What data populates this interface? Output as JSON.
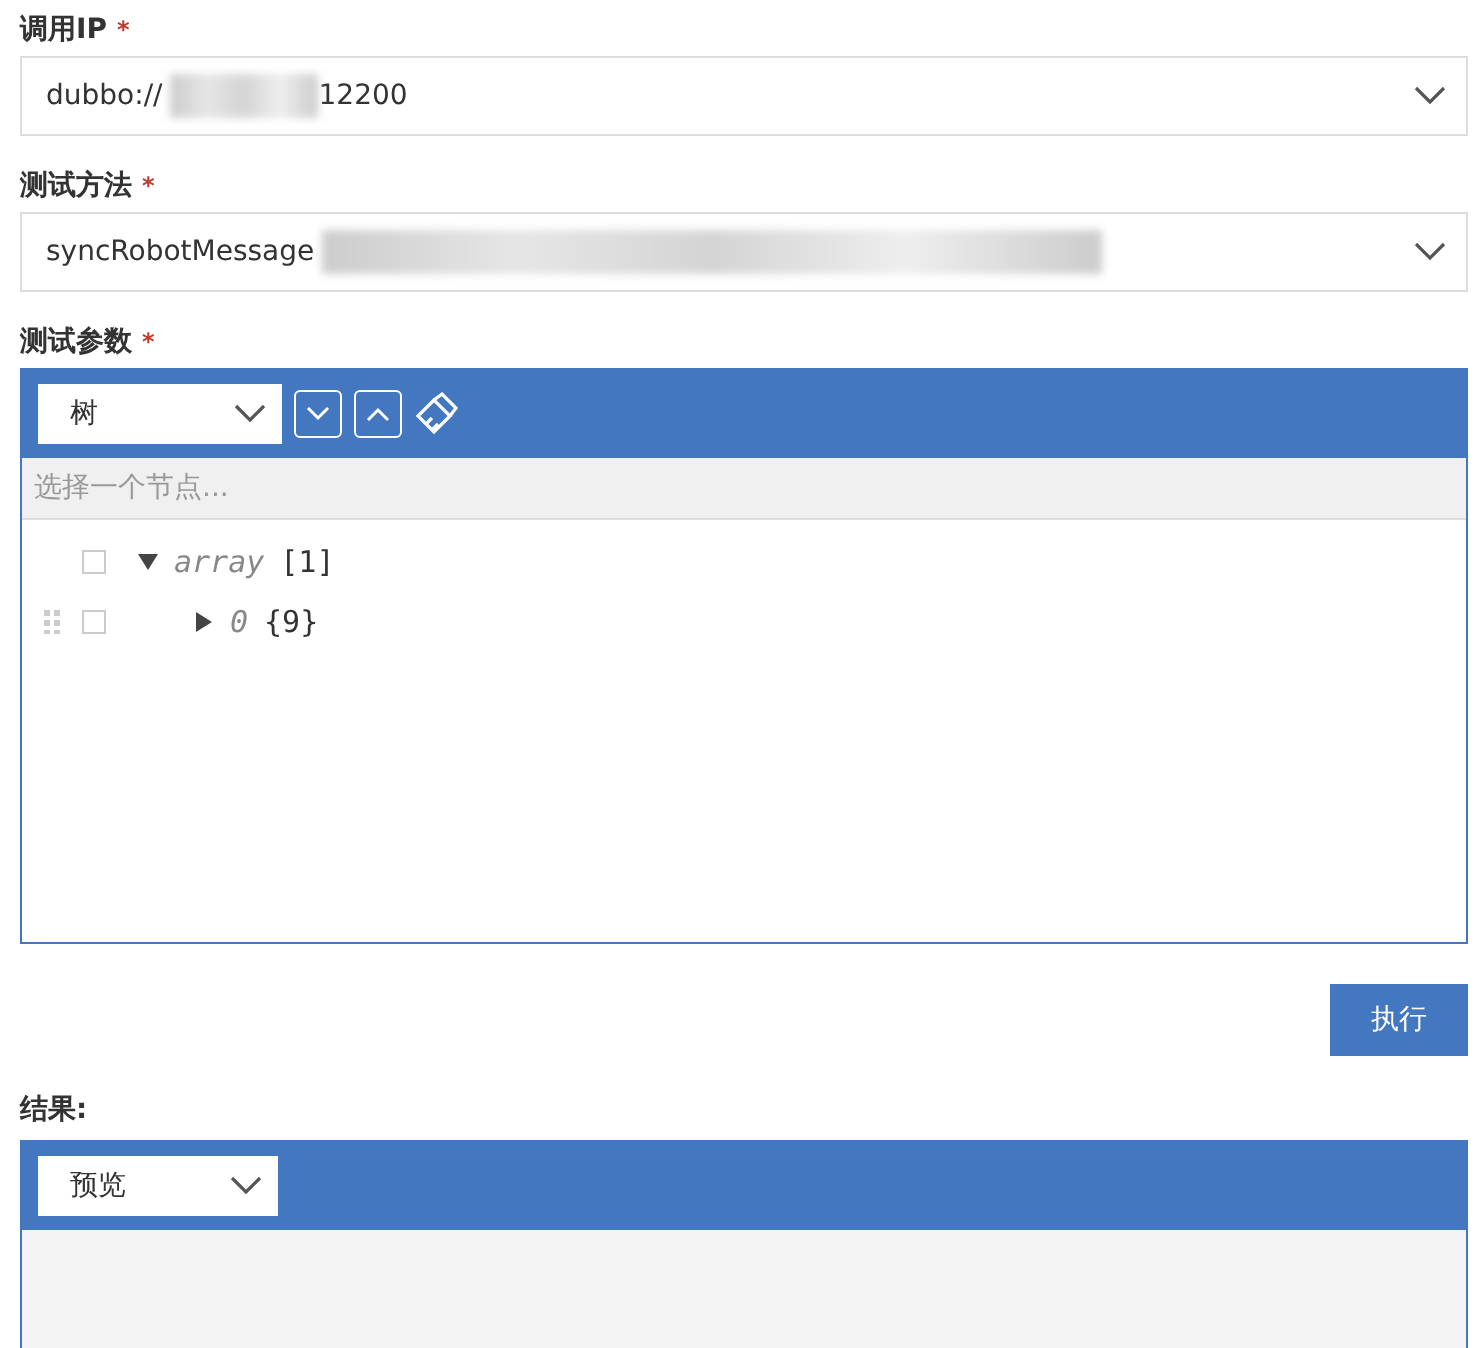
{
  "fields": [
    {
      "label": "调用IP",
      "required_mark": "*",
      "value_prefix": "dubbo://",
      "redacted": true,
      "value_suffix": "12200"
    },
    {
      "label": "测试方法",
      "required_mark": "*",
      "value_prefix": "syncRobotMessage",
      "redacted": true
    }
  ],
  "params": {
    "label": "测试参数",
    "required_mark": "*",
    "mode": "树",
    "search_placeholder": "选择一个节点...",
    "nodes": [
      {
        "key": "array",
        "type": "[1]",
        "checked": false,
        "expanded": true,
        "children": [
          {
            "key": "0",
            "type": "{9}",
            "checked": false,
            "expanded": false
          }
        ]
      }
    ]
  },
  "run_button": "执行",
  "result": {
    "label": "结果:",
    "mode": "预览"
  }
}
